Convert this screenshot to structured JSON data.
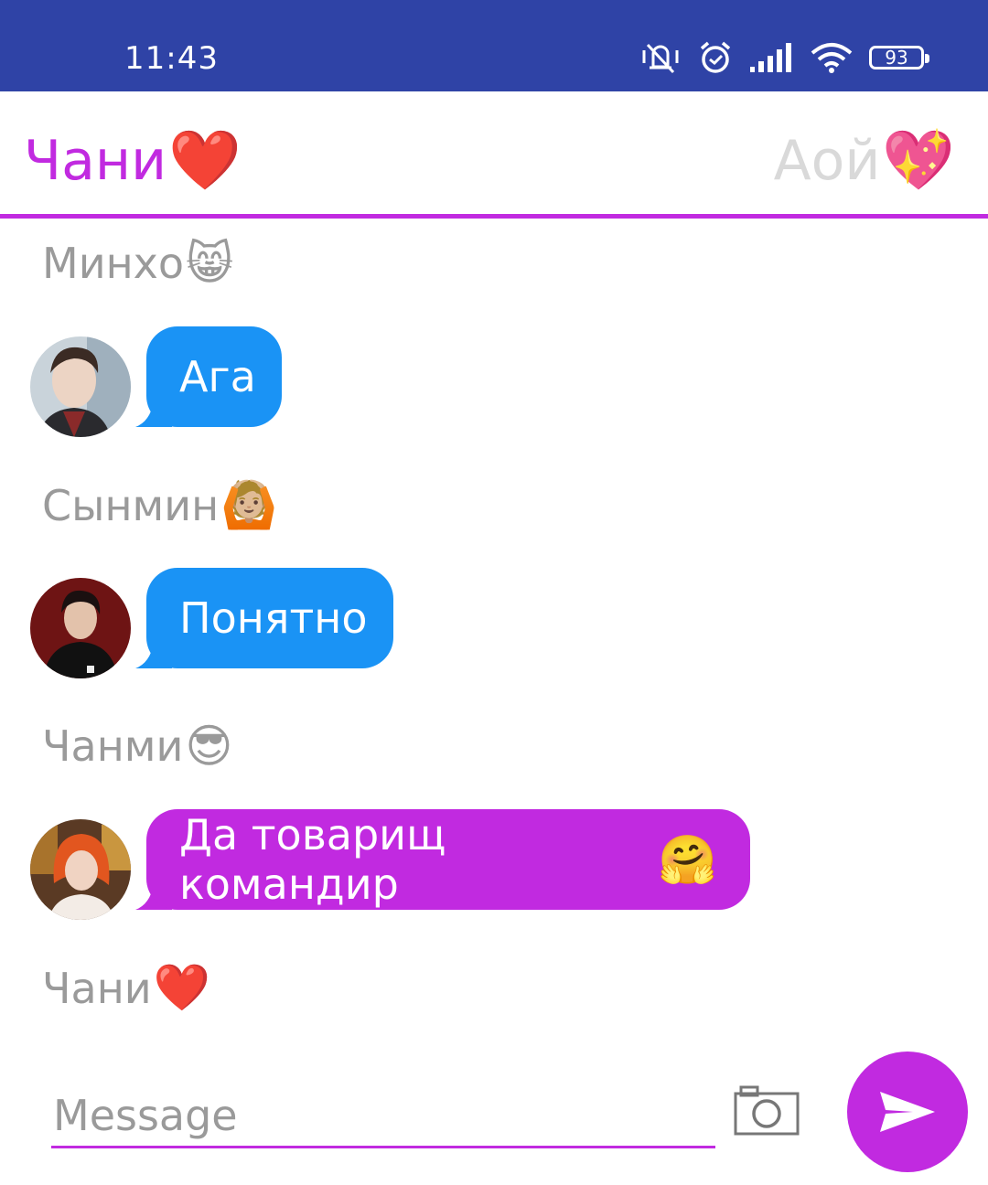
{
  "status_bar": {
    "time": "11:43",
    "battery": "93"
  },
  "tabs": [
    {
      "label": "Чани",
      "emoji": "❤️"
    },
    {
      "label": "Аой",
      "emoji": "💖"
    }
  ],
  "messages": [
    {
      "sender": "Минхо",
      "sender_emoji": "😸",
      "text": "Ага",
      "text_emoji": "",
      "color": "#1a93f5"
    },
    {
      "sender": "Сынмин",
      "sender_emoji": "🙆🏼",
      "text": "Понятно",
      "text_emoji": "",
      "color": "#1a93f5"
    },
    {
      "sender": "Чанми",
      "sender_emoji": "😎",
      "text": "Да товарищ командир",
      "text_emoji": "🤗",
      "color": "#c12ae0"
    }
  ],
  "last_sender": {
    "name": "Чани",
    "emoji": "❤️"
  },
  "composer": {
    "placeholder": "Message",
    "camera_icon": "camera-icon",
    "send_icon": "send-icon"
  },
  "colors": {
    "accent": "#c12ae0",
    "status_bar": "#2f43a6",
    "bubble_blue": "#1a93f5"
  }
}
